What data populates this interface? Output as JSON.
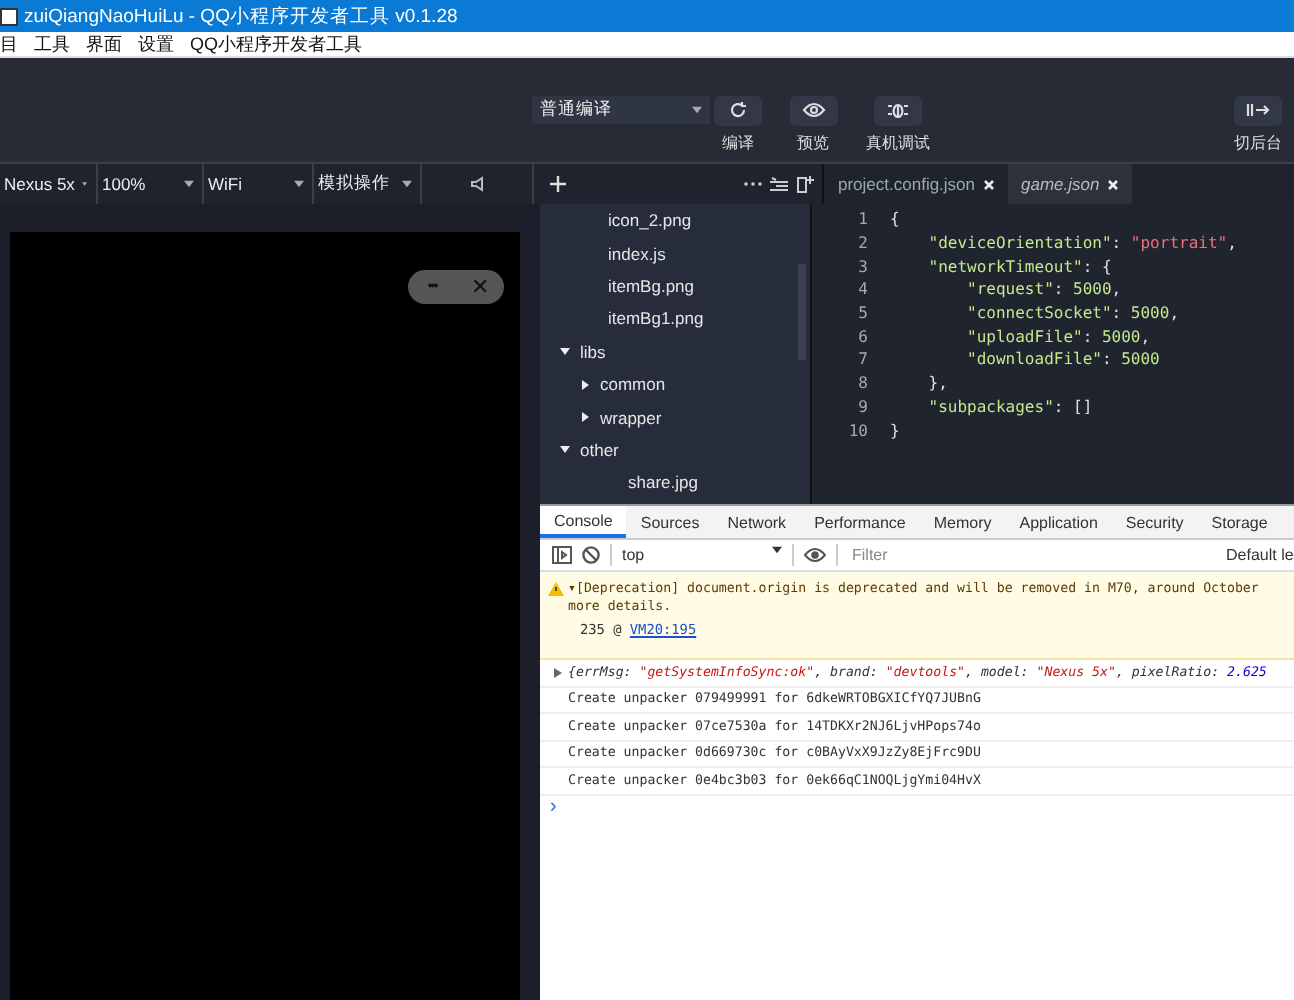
{
  "window": {
    "title": "zuiQiangNaoHuiLu - QQ小程序开发者工具 v0.1.28"
  },
  "menu": [
    "目",
    "工具",
    "界面",
    "设置",
    "QQ小程序开发者工具"
  ],
  "toolbar": {
    "compile_mode": "普通编译",
    "buttons": [
      {
        "kind": "compile",
        "label": "编译"
      },
      {
        "kind": "preview",
        "label": "预览"
      },
      {
        "kind": "debug",
        "label": "真机调试"
      },
      {
        "kind": "background",
        "label": "切后台"
      }
    ]
  },
  "device_bar": [
    {
      "kind": "select",
      "label": "Nexus 5x"
    },
    {
      "kind": "select",
      "label": "100%"
    },
    {
      "kind": "select",
      "label": "WiFi"
    },
    {
      "kind": "select",
      "label": "模拟操作"
    },
    {
      "kind": "speaker"
    }
  ],
  "simulator": {
    "capsule": {
      "more": "•••",
      "close": "✕"
    }
  },
  "file_tree": {
    "items": [
      {
        "kind": "file",
        "name": "icon_2.png"
      },
      {
        "kind": "file",
        "name": "index.js"
      },
      {
        "kind": "file",
        "name": "itemBg.png"
      },
      {
        "kind": "file",
        "name": "itemBg1.png"
      },
      {
        "kind": "folder",
        "name": "libs",
        "expanded": true,
        "children": [
          {
            "kind": "folder",
            "name": "common",
            "expanded": false
          },
          {
            "kind": "folder",
            "name": "wrapper",
            "expanded": false
          }
        ]
      },
      {
        "kind": "folder",
        "name": "other",
        "expanded": true,
        "children": [
          {
            "kind": "file",
            "name": "share.jpg"
          }
        ]
      }
    ]
  },
  "editor": {
    "tabs": [
      {
        "label": "project.config.json",
        "selected": false
      },
      {
        "label": "game.json",
        "selected": true
      }
    ],
    "lines": [
      {
        "number": "1",
        "tokens": [
          {
            "kind": "punct",
            "text": "{"
          }
        ]
      },
      {
        "number": "2",
        "tokens": [
          {
            "kind": "key",
            "text": "    \"deviceOrientation\""
          },
          {
            "kind": "punct",
            "text": ": "
          },
          {
            "kind": "string",
            "text": "\"portrait\""
          },
          {
            "kind": "punct",
            "text": ","
          }
        ]
      },
      {
        "number": "3",
        "tokens": [
          {
            "kind": "key",
            "text": "    \"networkTimeout\""
          },
          {
            "kind": "punct",
            "text": ": {"
          }
        ]
      },
      {
        "number": "4",
        "tokens": [
          {
            "kind": "key",
            "text": "        \"request\""
          },
          {
            "kind": "punct",
            "text": ": "
          },
          {
            "kind": "number",
            "text": "5000"
          },
          {
            "kind": "punct",
            "text": ","
          }
        ]
      },
      {
        "number": "5",
        "tokens": [
          {
            "kind": "key",
            "text": "        \"connectSocket\""
          },
          {
            "kind": "punct",
            "text": ": "
          },
          {
            "kind": "number",
            "text": "5000"
          },
          {
            "kind": "punct",
            "text": ","
          }
        ]
      },
      {
        "number": "6",
        "tokens": [
          {
            "kind": "key",
            "text": "        \"uploadFile\""
          },
          {
            "kind": "punct",
            "text": ": "
          },
          {
            "kind": "number",
            "text": "5000"
          },
          {
            "kind": "punct",
            "text": ","
          }
        ]
      },
      {
        "number": "7",
        "tokens": [
          {
            "kind": "key",
            "text": "        \"downloadFile\""
          },
          {
            "kind": "punct",
            "text": ": "
          },
          {
            "kind": "number",
            "text": "5000"
          }
        ]
      },
      {
        "number": "8",
        "tokens": [
          {
            "kind": "punct",
            "text": "    },"
          }
        ]
      },
      {
        "number": "9",
        "tokens": [
          {
            "kind": "key",
            "text": "    \"subpackages\""
          },
          {
            "kind": "punct",
            "text": ": []"
          }
        ]
      },
      {
        "number": "10",
        "tokens": [
          {
            "kind": "punct",
            "text": "}"
          }
        ]
      }
    ]
  },
  "devtools": {
    "tabs": [
      {
        "label": "Console",
        "selected": true
      },
      {
        "label": "Sources",
        "selected": false
      },
      {
        "label": "Network",
        "selected": false
      },
      {
        "label": "Performance",
        "selected": false
      },
      {
        "label": "Memory",
        "selected": false
      },
      {
        "label": "Application",
        "selected": false
      },
      {
        "label": "Security",
        "selected": false
      },
      {
        "label": "Storage",
        "selected": false
      }
    ],
    "context": "top",
    "filter": {
      "placeholder": "Filter"
    },
    "levels": "Default le",
    "entries": [
      {
        "kind": "warning",
        "text": "▾[Deprecation] document.origin is deprecated and will be removed in M70, around October",
        "more": "more details.",
        "source_prefix": "235 @ ",
        "source_link": "VM20:195"
      },
      {
        "kind": "object",
        "tokens": [
          {
            "kind": "plain",
            "text": "{errMsg: "
          },
          {
            "kind": "string",
            "text": "\"getSystemInfoSync:ok\""
          },
          {
            "kind": "plain",
            "text": ", brand: "
          },
          {
            "kind": "string",
            "text": "\"devtools\""
          },
          {
            "kind": "plain",
            "text": ", model: "
          },
          {
            "kind": "string",
            "text": "\"Nexus 5x\""
          },
          {
            "kind": "plain",
            "text": ", pixelRatio: "
          },
          {
            "kind": "number",
            "text": "2.625"
          }
        ]
      },
      {
        "kind": "log",
        "text": "Create unpacker 079499991 for 6dkeWRTOBGXICfYQ7JUBnG"
      },
      {
        "kind": "log",
        "text": "Create unpacker 07ce7530a for 14TDKXr2NJ6LjvHPops74o"
      },
      {
        "kind": "log",
        "text": "Create unpacker 0d669730c for c0BAyVxX9JzZy8EjFrc9DU"
      },
      {
        "kind": "log",
        "text": "Create unpacker 0e4bc3b03 for 0ek66qC1NOQLjgYmi04HvX"
      }
    ],
    "prompt": "›"
  }
}
